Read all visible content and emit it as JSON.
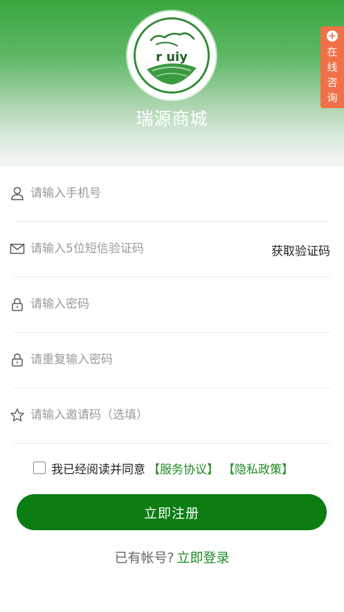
{
  "header": {
    "brand_title": "瑞源商城",
    "logo_text": "r uiy",
    "online_consult": "在线咨询"
  },
  "form": {
    "phone_placeholder": "请输入手机号",
    "sms_placeholder": "请输入5位短信验证码",
    "get_code_label": "获取验证码",
    "password_placeholder": "请输入密码",
    "repeat_password_placeholder": "请重复输入密码",
    "invite_placeholder": "请输入邀请码（选填）"
  },
  "agreement": {
    "text": "我已经阅读并同意",
    "service_link": "【服务协议】",
    "privacy_link": "【隐私政策】"
  },
  "register_label": "立即注册",
  "login_prompt": {
    "text": "已有帐号?",
    "link": "立即登录"
  },
  "colors": {
    "primary_green": "#0b7d12",
    "link_green": "#1f8a24",
    "accent_orange": "#f07048"
  }
}
